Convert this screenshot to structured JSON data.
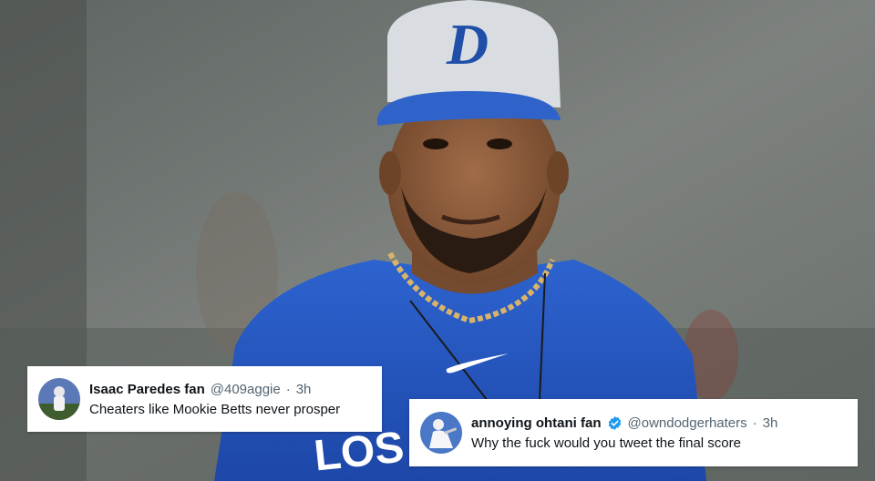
{
  "photo": {
    "cap_letter": "D",
    "jersey_text": "LOS",
    "colors": {
      "background": "#6f7471",
      "cap_crown": "#d9dde1",
      "cap_brim": "#2f63c9",
      "logo": "#1f4fa8",
      "jersey": "#2458c4",
      "skin": "#8a5a3c",
      "chain": "#d8b46a"
    }
  },
  "tweets": [
    {
      "display_name": "Isaac Paredes fan",
      "handle": "@409aggie",
      "separator": "·",
      "time": "3h",
      "text": "Cheaters like Mookie Betts never prosper",
      "verified": false,
      "avatar_icon": "avatar-player-photo"
    },
    {
      "display_name": "annoying ohtani fan",
      "handle": "@owndodgerhaters",
      "separator": "·",
      "time": "3h",
      "text": "Why the fuck would you tweet the final score",
      "verified": true,
      "verified_color": "#1d9bf0",
      "avatar_icon": "avatar-player-photo"
    }
  ]
}
